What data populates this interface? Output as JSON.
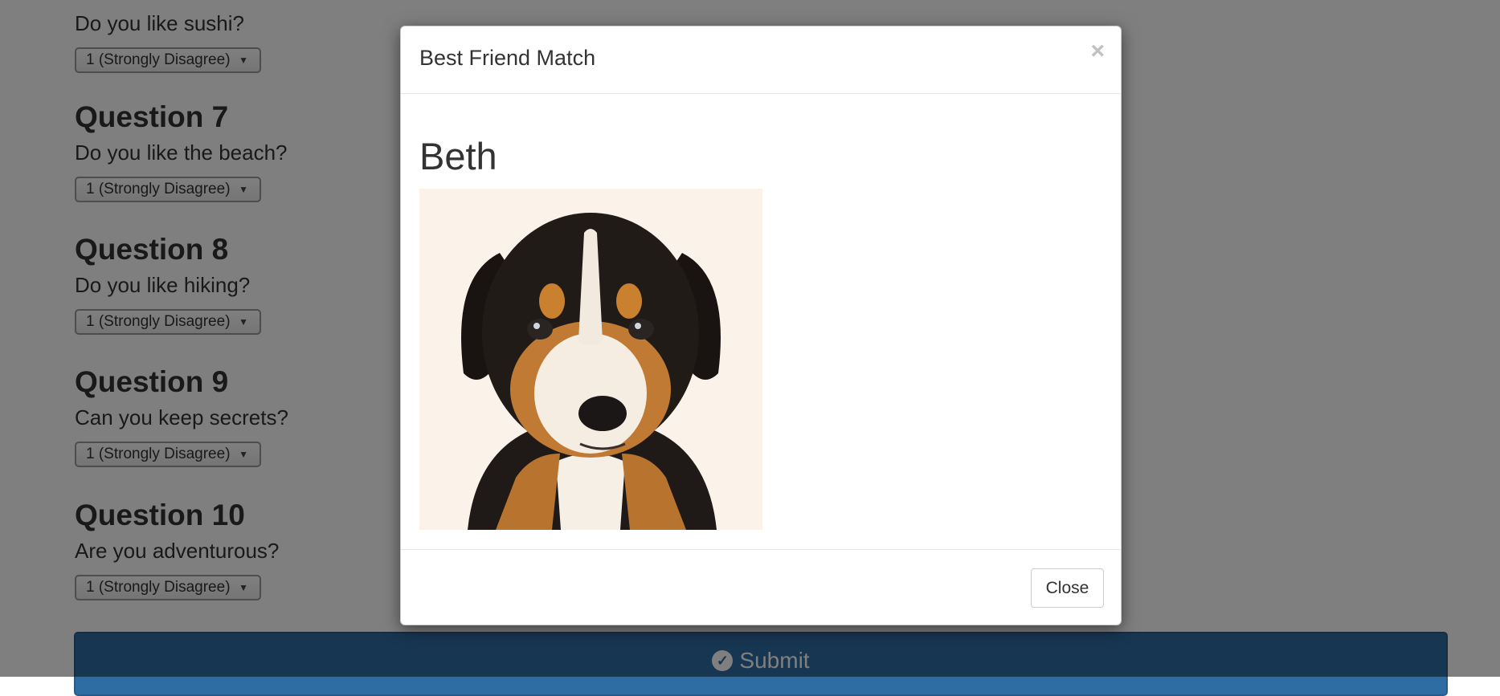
{
  "questions": [
    {
      "title": "",
      "text": "Do you like sushi?",
      "answer": "1 (Strongly Disagree)"
    },
    {
      "title": "Question 7",
      "text": "Do you like the beach?",
      "answer": "1 (Strongly Disagree)"
    },
    {
      "title": "Question 8",
      "text": "Do you like hiking?",
      "answer": "1 (Strongly Disagree)"
    },
    {
      "title": "Question 9",
      "text": "Can you keep secrets?",
      "answer": "1 (Strongly Disagree)"
    },
    {
      "title": "Question 10",
      "text": "Are you adventurous?",
      "answer": "1 (Strongly Disagree)"
    }
  ],
  "submit": {
    "label": "Submit",
    "icon": "check-circle-icon",
    "color": "#2e6da4"
  },
  "modal": {
    "title": "Best Friend Match",
    "close_symbol": "×",
    "match_name": "Beth",
    "photo": "puppy-photo",
    "close_label": "Close"
  }
}
